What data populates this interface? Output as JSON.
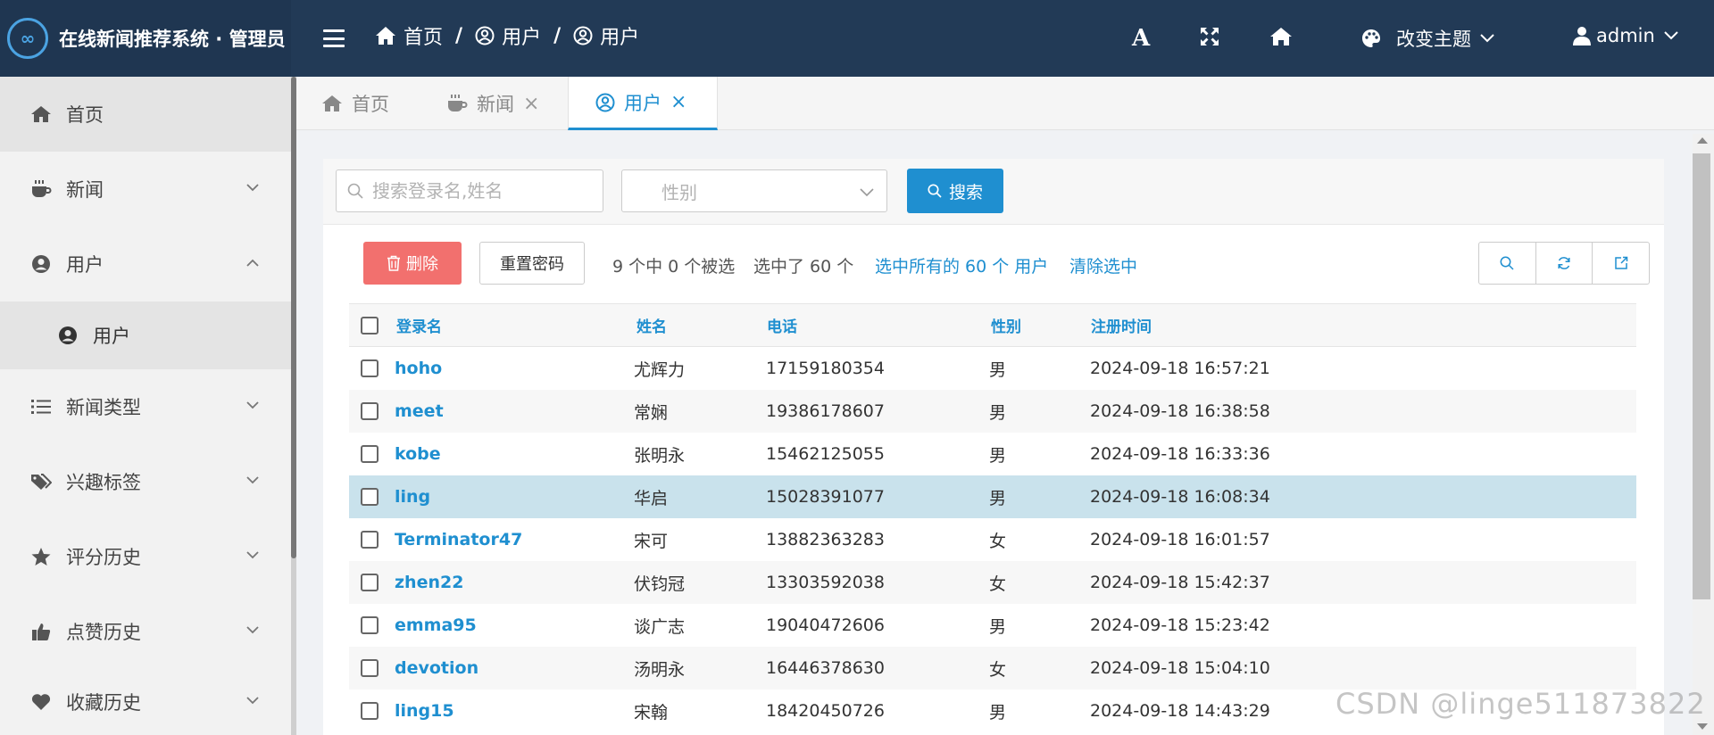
{
  "brand": {
    "logo": "∞",
    "title": "在线新闻推荐系统 · 管理员"
  },
  "breadcrumb": [
    {
      "label": "首页",
      "icon": "home-icon"
    },
    {
      "label": "用户",
      "icon": "user-circle-icon"
    },
    {
      "label": "用户",
      "icon": "user-circle-icon"
    }
  ],
  "breadcrumb_separator": "/",
  "topbar": {
    "font_icon": "A",
    "theme_label": "改变主题",
    "user_label": "admin"
  },
  "sidebar": {
    "items": [
      {
        "label": "首页",
        "icon": "home-icon",
        "active": true
      },
      {
        "label": "新闻",
        "icon": "coffee-icon"
      },
      {
        "label": "用户",
        "icon": "user-circle-icon",
        "expanded": true
      },
      {
        "label": "用户",
        "icon": "user-circle-icon",
        "sub": true
      },
      {
        "label": "新闻类型",
        "icon": "list-icon"
      },
      {
        "label": "兴趣标签",
        "icon": "tags-icon"
      },
      {
        "label": "评分历史",
        "icon": "star-icon"
      },
      {
        "label": "点赞历史",
        "icon": "thumbs-up-icon"
      },
      {
        "label": "收藏历史",
        "icon": "heart-icon"
      }
    ]
  },
  "tabs": [
    {
      "label": "首页",
      "icon": "home-icon",
      "closable": false
    },
    {
      "label": "新闻",
      "icon": "coffee-icon",
      "closable": true
    },
    {
      "label": "用户",
      "icon": "user-circle-icon",
      "closable": true,
      "active": true
    }
  ],
  "tab_close": "×",
  "filters": {
    "search_placeholder": "搜索登录名,姓名",
    "gender_placeholder": "性别",
    "search_button": "搜索"
  },
  "toolbar": {
    "delete_button": "删除",
    "reset_password_button": "重置密码",
    "selection_count": "9 个中 0 个被选",
    "selected_total": "选中了 60 个",
    "select_all_link": "选中所有的 60 个 用户",
    "clear_selection_link": "清除选中"
  },
  "table": {
    "columns": [
      "登录名",
      "姓名",
      "电话",
      "性别",
      "注册时间"
    ],
    "rows": [
      {
        "login": "hoho",
        "name": "尤辉力",
        "phone": "17159180354",
        "gender": "男",
        "registered": "2024-09-18 16:57:21"
      },
      {
        "login": "meet",
        "name": "常娴",
        "phone": "19386178607",
        "gender": "男",
        "registered": "2024-09-18 16:38:58"
      },
      {
        "login": "kobe",
        "name": "张明永",
        "phone": "15462125055",
        "gender": "男",
        "registered": "2024-09-18 16:33:36"
      },
      {
        "login": "ling",
        "name": "华启",
        "phone": "15028391077",
        "gender": "男",
        "registered": "2024-09-18 16:08:34"
      },
      {
        "login": "Terminator47",
        "name": "宋可",
        "phone": "13882363283",
        "gender": "女",
        "registered": "2024-09-18 16:01:57"
      },
      {
        "login": "zhen22",
        "name": "伏钧冠",
        "phone": "13303592038",
        "gender": "女",
        "registered": "2024-09-18 15:42:37"
      },
      {
        "login": "emma95",
        "name": "谈广志",
        "phone": "19040472606",
        "gender": "男",
        "registered": "2024-09-18 15:23:42"
      },
      {
        "login": "devotion",
        "name": "汤明永",
        "phone": "16446378630",
        "gender": "女",
        "registered": "2024-09-18 15:04:10"
      },
      {
        "login": "ling15",
        "name": "宋翰",
        "phone": "18420450726",
        "gender": "男",
        "registered": "2024-09-18 14:43:29"
      }
    ]
  },
  "watermark": "CSDN @linge511873822",
  "colors": {
    "topbar": "#223a56",
    "accent": "#1f8fd0",
    "danger": "#f2706e",
    "highlight_row": "#c9e2ec"
  }
}
